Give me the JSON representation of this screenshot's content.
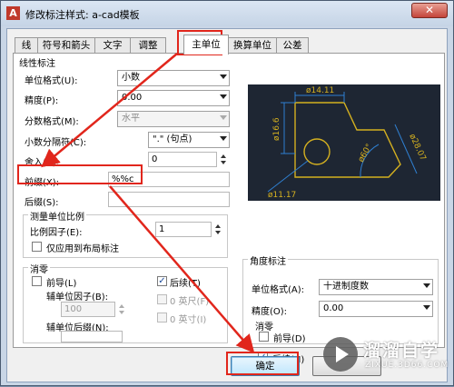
{
  "window": {
    "title": "修改标注样式: a-cad模板",
    "app_icon": "A",
    "close_label": "✕"
  },
  "tabs": [
    {
      "label": "线"
    },
    {
      "label": "符号和箭头"
    },
    {
      "label": "文字"
    },
    {
      "label": "调整"
    },
    {
      "label": "主单位",
      "active": true
    },
    {
      "label": "换算单位"
    },
    {
      "label": "公差"
    }
  ],
  "linear": {
    "group_title": "线性标注",
    "unit_format_label": "单位格式(U):",
    "unit_format_value": "小数",
    "precision_label": "精度(P):",
    "precision_value": "0.00",
    "fraction_format_label": "分数格式(M):",
    "fraction_format_value": "水平",
    "decimal_sep_label": "小数分隔符(C):",
    "decimal_sep_value": "\".\" (句点)",
    "round_label": "舍入(R):",
    "round_value": "0",
    "prefix_label": "前缀(X):",
    "prefix_value": "%%c",
    "suffix_label": "后缀(S):",
    "suffix_value": ""
  },
  "scale": {
    "group_title": "测量单位比例",
    "factor_label": "比例因子(E):",
    "factor_value": "1",
    "layout_only_label": "仅应用到布局标注"
  },
  "zero_suppress": {
    "group_title": "消零",
    "leading_label": "前导(L)",
    "trailing_label": "后续(T)",
    "sub_factor_label": "辅单位因子(B):",
    "sub_factor_value": "100",
    "sub_suffix_label": "辅单位后缀(N):",
    "feet_label": "0 英尺(F)",
    "inches_label": "0 英寸(I)"
  },
  "angular": {
    "group_title": "角度标注",
    "unit_format_label": "单位格式(A):",
    "unit_format_value": "十进制度数",
    "precision_label": "精度(O):",
    "precision_value": "0.00",
    "zero_title": "消零",
    "leading_label": "前导(D)",
    "trailing_label": "后续(N)"
  },
  "preview": {
    "dims": [
      "ø14.11",
      "ø16.6",
      "ø28.07",
      "ø60°",
      "ø11.17"
    ],
    "colors": {
      "background": "#1e2633",
      "geometry": "#d4b020",
      "dimension": "#2f7fd0",
      "text": "#d4b020"
    }
  },
  "buttons": {
    "ok_label": "确定"
  },
  "watermark": {
    "title": "溜溜自学",
    "url": "ZIXUE.3D66.COM"
  },
  "accent_color": "#e1261c"
}
